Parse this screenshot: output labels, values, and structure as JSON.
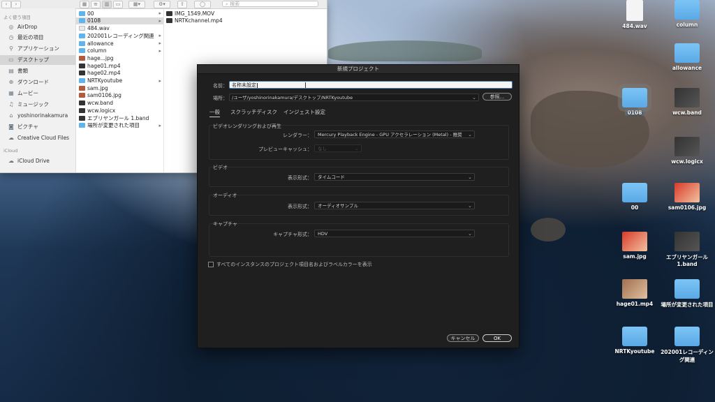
{
  "finder": {
    "search_placeholder": "検索",
    "sidebar_heading_favorites": "よく使う項目",
    "sidebar_heading_icloud": "iCloud",
    "sidebar_items": [
      {
        "label": "AirDrop",
        "icon": "airdrop-icon"
      },
      {
        "label": "最近の項目",
        "icon": "clock-icon"
      },
      {
        "label": "アプリケーション",
        "icon": "apps-icon"
      },
      {
        "label": "デスクトップ",
        "icon": "desktop-icon"
      },
      {
        "label": "書類",
        "icon": "document-icon"
      },
      {
        "label": "ダウンロード",
        "icon": "download-icon"
      },
      {
        "label": "ムービー",
        "icon": "movie-icon"
      },
      {
        "label": "ミュージック",
        "icon": "music-icon"
      },
      {
        "label": "yoshinorinakamura",
        "icon": "home-icon"
      },
      {
        "label": "ピクチャ",
        "icon": "camera-icon"
      },
      {
        "label": "Creative Cloud Files",
        "icon": "cloud-icon"
      }
    ],
    "icloud_items": [
      {
        "label": "iCloud Drive",
        "icon": "icloud-icon"
      }
    ],
    "column1": [
      {
        "label": "00",
        "type": "folder",
        "arrow": true
      },
      {
        "label": "0108",
        "type": "folder",
        "arrow": true
      },
      {
        "label": "484.wav",
        "type": "file",
        "arrow": false
      },
      {
        "label": "202001レコーディング関連",
        "type": "folder",
        "arrow": true
      },
      {
        "label": "allowance",
        "type": "folder",
        "arrow": true
      },
      {
        "label": "column",
        "type": "folder",
        "arrow": true
      },
      {
        "label": "hage...jpg",
        "type": "img",
        "arrow": false
      },
      {
        "label": "hage01.mp4",
        "type": "dark",
        "arrow": false
      },
      {
        "label": "hage02.mp4",
        "type": "dark",
        "arrow": false
      },
      {
        "label": "NRTKyoutube",
        "type": "folder",
        "arrow": true
      },
      {
        "label": "sam.jpg",
        "type": "img",
        "arrow": false
      },
      {
        "label": "sam0106.jpg",
        "type": "img",
        "arrow": false
      },
      {
        "label": "wcw.band",
        "type": "dark",
        "arrow": false
      },
      {
        "label": "wcw.logicx",
        "type": "dark",
        "arrow": false
      },
      {
        "label": "エブリヤンガール 1.band",
        "type": "dark",
        "arrow": false
      },
      {
        "label": "場所が変更された項目",
        "type": "folder",
        "arrow": true
      }
    ],
    "column2": [
      {
        "label": "IMG_1549.MOV",
        "type": "dark"
      },
      {
        "label": "NRTKchannel.mp4",
        "type": "dark"
      }
    ]
  },
  "dialog": {
    "title": "新規プロジェクト",
    "name_label": "名前：",
    "name_value": "名称未設定",
    "location_label": "場所：",
    "location_value": "/ユーザ/yoshinorinakamura/デスクトップ/NRTKyoutube",
    "browse_button": "参照...",
    "tabs": [
      "一般",
      "スクラッチディスク",
      "インジェスト設定"
    ],
    "video_rendering": {
      "title": "ビデオレンダリングおよび再生",
      "renderer_label": "レンダラー：",
      "renderer_value": "Mercury Playback Engine - GPU アクセラレーション (Metal) - 推奨",
      "preview_cache_label": "プレビューキャッシュ：",
      "preview_cache_value": "なし"
    },
    "video": {
      "title": "ビデオ",
      "display_format_label": "表示形式：",
      "display_format_value": "タイムコード"
    },
    "audio": {
      "title": "オーディオ",
      "display_format_label": "表示形式：",
      "display_format_value": "オーディオサンプル"
    },
    "capture": {
      "title": "キャプチャ",
      "capture_format_label": "キャプチャ形式：",
      "capture_format_value": "HDV"
    },
    "checkbox_label": "すべてのインスタンスのプロジェクト項目名およびラベルカラーを表示",
    "cancel_button": "キャンセル",
    "ok_button": "OK"
  },
  "desktop_icons": [
    {
      "label": "484.wav",
      "kind": "doc"
    },
    {
      "label": "column",
      "kind": "folder"
    },
    {
      "label": "allowance",
      "kind": "folder"
    },
    {
      "label": "0108",
      "kind": "folder"
    },
    {
      "label": "wcw.band",
      "kind": "thumb"
    },
    {
      "label": "wcw.logicx",
      "kind": "thumb"
    },
    {
      "label": "00",
      "kind": "folder"
    },
    {
      "label": "sam0106.jpg",
      "kind": "red"
    },
    {
      "label": "sam.jpg",
      "kind": "red"
    },
    {
      "label": "エブリヤンガール 1.band",
      "kind": "thumb"
    },
    {
      "label": "hage01.mp4",
      "kind": "person"
    },
    {
      "label": "場所が変更された項目",
      "kind": "folder"
    },
    {
      "label": "NRTKyoutube",
      "kind": "folder"
    },
    {
      "label": "202001レコーディング関連",
      "kind": "folder"
    }
  ]
}
